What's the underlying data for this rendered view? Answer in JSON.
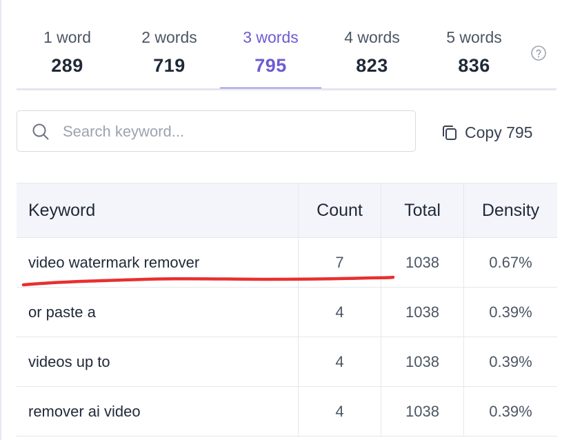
{
  "tabs": [
    {
      "label": "1 word",
      "count": "289"
    },
    {
      "label": "2 words",
      "count": "719"
    },
    {
      "label": "3 words",
      "count": "795",
      "active": true
    },
    {
      "label": "4 words",
      "count": "823"
    },
    {
      "label": "5 words",
      "count": "836"
    }
  ],
  "help": {
    "icon": "question-circle-icon"
  },
  "search": {
    "placeholder": "Search keyword...",
    "value": "",
    "icon": "search-icon"
  },
  "copy": {
    "label": "Copy 795",
    "icon": "copy-icon"
  },
  "table": {
    "headers": {
      "keyword": "Keyword",
      "count": "Count",
      "total": "Total",
      "density": "Density"
    },
    "rows": [
      {
        "keyword": "video watermark remover",
        "count": "7",
        "total": "1038",
        "density": "0.67%"
      },
      {
        "keyword": "or paste a",
        "count": "4",
        "total": "1038",
        "density": "0.39%"
      },
      {
        "keyword": "videos up to",
        "count": "4",
        "total": "1038",
        "density": "0.39%"
      },
      {
        "keyword": "remover ai video",
        "count": "4",
        "total": "1038",
        "density": "0.39%"
      }
    ]
  },
  "colors": {
    "accent": "#6b5bd3",
    "annotation": "#e8302f",
    "header_bg": "#f4f5fb",
    "border": "#e5e7eb"
  }
}
